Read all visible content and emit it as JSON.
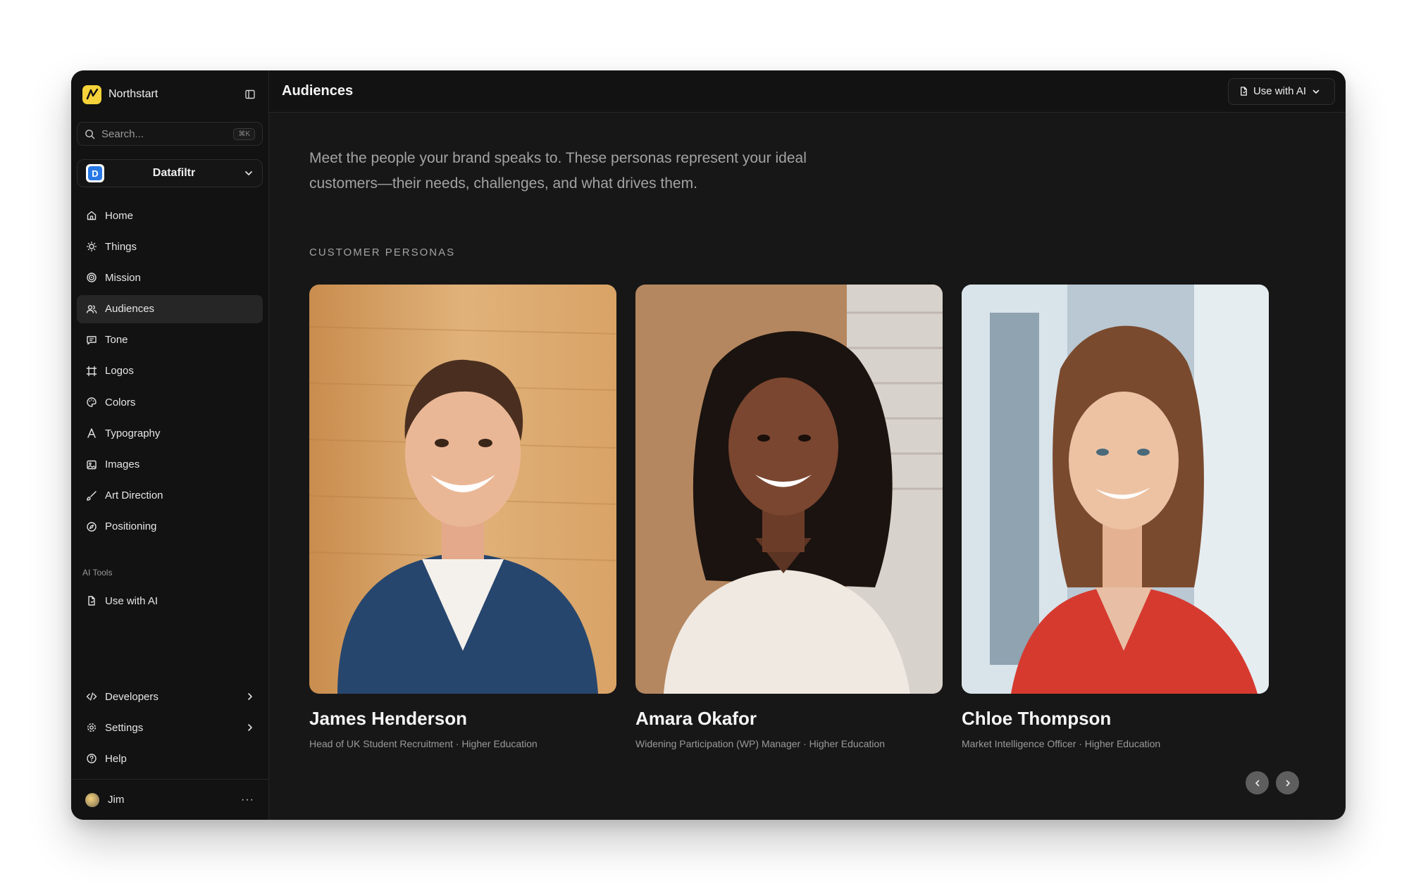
{
  "brand": {
    "name": "Northstart"
  },
  "search": {
    "placeholder": "Search...",
    "shortcut": "⌘K"
  },
  "workspace": {
    "badge": "D",
    "name": "Datafiltr"
  },
  "nav": {
    "items": [
      {
        "label": "Home",
        "icon": "home-icon"
      },
      {
        "label": "Things",
        "icon": "lightbulb-icon"
      },
      {
        "label": "Mission",
        "icon": "target-icon"
      },
      {
        "label": "Audiences",
        "icon": "users-icon",
        "active": true
      },
      {
        "label": "Tone",
        "icon": "message-icon"
      },
      {
        "label": "Logos",
        "icon": "frame-icon"
      },
      {
        "label": "Colors",
        "icon": "palette-icon"
      },
      {
        "label": "Typography",
        "icon": "type-icon"
      },
      {
        "label": "Images",
        "icon": "image-icon"
      },
      {
        "label": "Art Direction",
        "icon": "brush-icon"
      },
      {
        "label": "Positioning",
        "icon": "compass-icon"
      }
    ],
    "ai_section_label": "AI Tools",
    "ai_items": [
      {
        "label": "Use with AI",
        "icon": "file-ai-icon"
      }
    ],
    "bottom_items": [
      {
        "label": "Developers",
        "icon": "code-icon"
      },
      {
        "label": "Settings",
        "icon": "gear-icon"
      },
      {
        "label": "Help",
        "icon": "help-icon"
      }
    ]
  },
  "user": {
    "name": "Jim",
    "menu": "···"
  },
  "header": {
    "title": "Audiences",
    "use_ai_label": "Use with AI"
  },
  "main": {
    "intro": "Meet the people your brand speaks to. These personas represent your ideal customers—their needs, challenges, and what drives them.",
    "section_label": "CUSTOMER PERSONAS",
    "personas": [
      {
        "name": "James Henderson",
        "role": "Head of UK Student Recruitment · Higher Education"
      },
      {
        "name": "Amara Okafor",
        "role": "Widening Participation (WP) Manager · Higher Education"
      },
      {
        "name": "Chloe Thompson",
        "role": "Market Intelligence Officer · Higher Education"
      }
    ]
  },
  "colors": {
    "accent_logo": "#f6d33a",
    "workspace_badge": "#2878e6",
    "background": "#171717"
  }
}
